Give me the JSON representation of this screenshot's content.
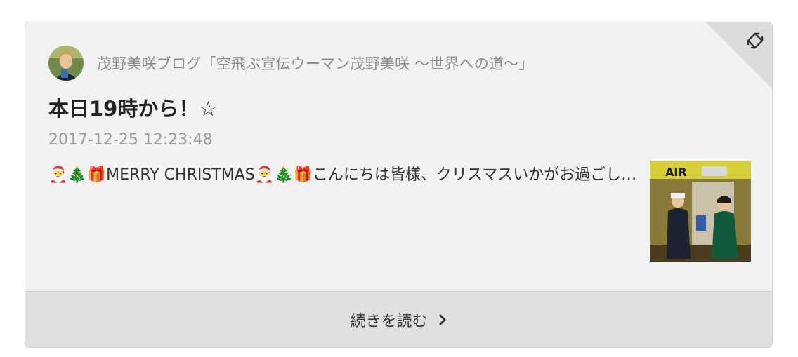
{
  "card": {
    "blog_name": "茂野美咲ブログ「空飛ぶ宣伝ウーマン茂野美咲 〜世界への道〜」",
    "title": "本日19時から！☆",
    "date": "2017-12-25 12:23:48",
    "excerpt": "🎅🎄🎁MERRY CHRISTMAS🎅🎄🎁こんにちは皆様、クリスマスいかがお過ごし…",
    "read_more": "続きを読む",
    "thumbnail_sign": "AIR"
  },
  "icons": {
    "corner": "expand-arrows-icon",
    "chevron": "chevron-right-icon"
  },
  "colors": {
    "card_bg": "#f2f2f2",
    "footer_bg": "#e0e0e0",
    "meta_text": "#8a8a8a"
  }
}
